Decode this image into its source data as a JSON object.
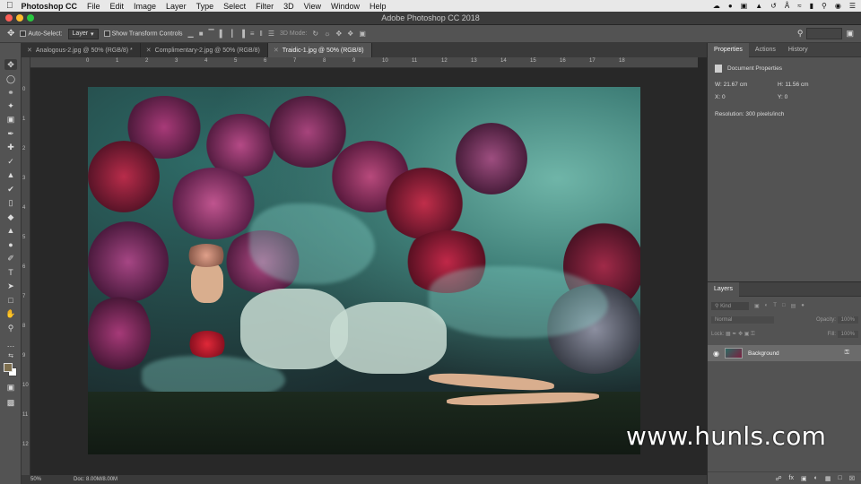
{
  "menubar": {
    "app": "Photoshop CC",
    "items": [
      "File",
      "Edit",
      "Image",
      "Layer",
      "Type",
      "Select",
      "Filter",
      "3D",
      "View",
      "Window",
      "Help"
    ]
  },
  "titlebar": {
    "title": "Adobe Photoshop CC 2018"
  },
  "options": {
    "auto_select_label": "Auto-Select:",
    "auto_select_value": "Layer",
    "transform_label": "Show Transform Controls",
    "mode3d_label": "3D Mode:"
  },
  "tabs": [
    {
      "label": "Analogous-2.jpg @ 50% (RGB/8) *"
    },
    {
      "label": "Complimentary-2.jpg @ 50% (RGB/8)"
    },
    {
      "label": "Traidic-1.jpg @ 50% (RGB/8)"
    }
  ],
  "ruler_h": [
    "0",
    "1",
    "2",
    "3",
    "4",
    "5",
    "6",
    "7",
    "8",
    "9",
    "10",
    "11",
    "12",
    "13",
    "14",
    "15",
    "16",
    "17",
    "18"
  ],
  "ruler_v": [
    "0",
    "1",
    "2",
    "3",
    "4",
    "5",
    "6",
    "7",
    "8",
    "9",
    "10",
    "11",
    "12"
  ],
  "status": {
    "zoom": "50%",
    "doc": "Doc: 8.00M/8.00M"
  },
  "watermark": "www.hunls.com",
  "properties": {
    "tabs": [
      "Properties",
      "Actions",
      "History"
    ],
    "section_title": "Document Properties",
    "w_label": "W:",
    "w_value": "21.67 cm",
    "h_label": "H:",
    "h_value": "11.56 cm",
    "x_label": "X:",
    "x_value": "0",
    "y_label": "Y:",
    "y_value": "0",
    "resolution": "Resolution: 300 pixels/inch"
  },
  "layers": {
    "title": "Layers",
    "kind_placeholder": "Kind",
    "blend_mode": "Normal",
    "opacity_label": "Opacity:",
    "opacity_value": "100%",
    "lock_label": "Lock:",
    "fill_label": "Fill:",
    "fill_value": "100%",
    "layer_name": "Background"
  },
  "colors": {
    "foreground": "#7e6f4e",
    "background": "#ffffff"
  }
}
